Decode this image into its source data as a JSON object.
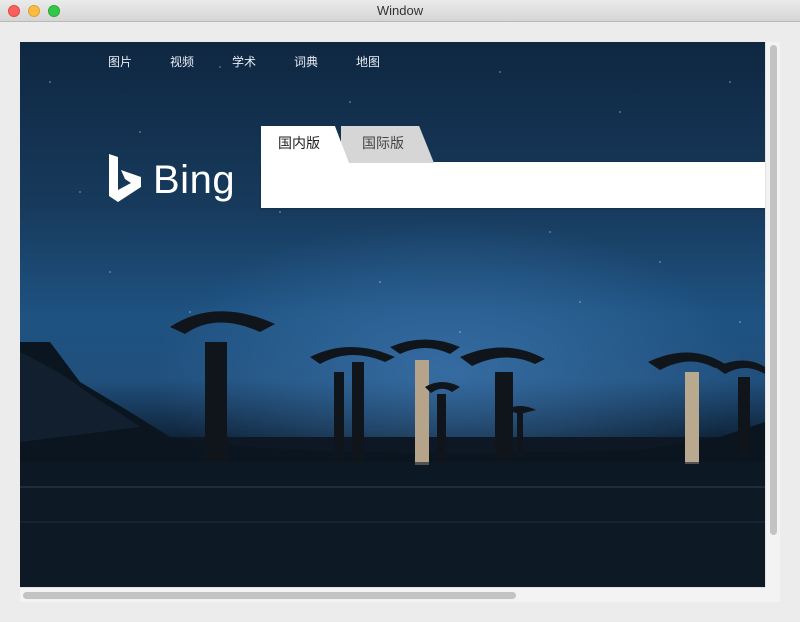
{
  "window": {
    "title": "Window"
  },
  "nav": {
    "items": [
      {
        "label": "图片"
      },
      {
        "label": "视频"
      },
      {
        "label": "学术"
      },
      {
        "label": "词典"
      },
      {
        "label": "地图"
      }
    ]
  },
  "logo": {
    "text": "Bing"
  },
  "search": {
    "tabs": [
      {
        "label": "国内版",
        "selected": true
      },
      {
        "label": "国际版",
        "selected": false
      }
    ],
    "value": ""
  },
  "colors": {
    "accent_tab_inactive": "#d6d6d6",
    "sky_top": "#0f2741",
    "sky_mid": "#1e5281"
  },
  "scrollbars": {
    "vertical_fraction": 0.9,
    "horizontal_fraction": 0.66
  }
}
